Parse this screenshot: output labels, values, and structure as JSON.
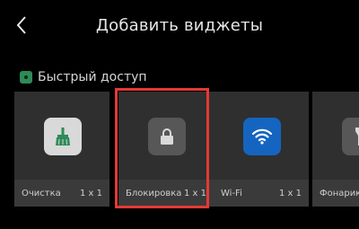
{
  "header": {
    "title": "Добавить виджеты",
    "back_icon": "chevron-left-icon"
  },
  "section": {
    "label": "Быстрый доступ",
    "icon": "quick-access-icon",
    "icon_color": "#2e8b57"
  },
  "widgets": [
    {
      "name": "Очистка",
      "size": "1 x 1",
      "icon": "broom-icon",
      "icon_bg": "#d9d9d9",
      "icon_color": "#2e8b57"
    },
    {
      "name": "Блокировка",
      "size": "1 x 1",
      "icon": "lock-icon",
      "icon_bg": "#575757",
      "icon_color": "#d9d9d9",
      "selected": true
    },
    {
      "name": "Wi-Fi",
      "size": "1 x 1",
      "icon": "wifi-icon",
      "icon_bg": "#1565c0",
      "icon_color": "#ffffff"
    },
    {
      "name": "Фонарик",
      "size": "",
      "icon": "flashlight-icon",
      "icon_bg": "#575757",
      "icon_color": "#d9d9d9"
    }
  ],
  "colors": {
    "background": "#000000",
    "card": "#2f2f2f",
    "card_footer": "#3a3a3a",
    "selection": "#e53935"
  }
}
